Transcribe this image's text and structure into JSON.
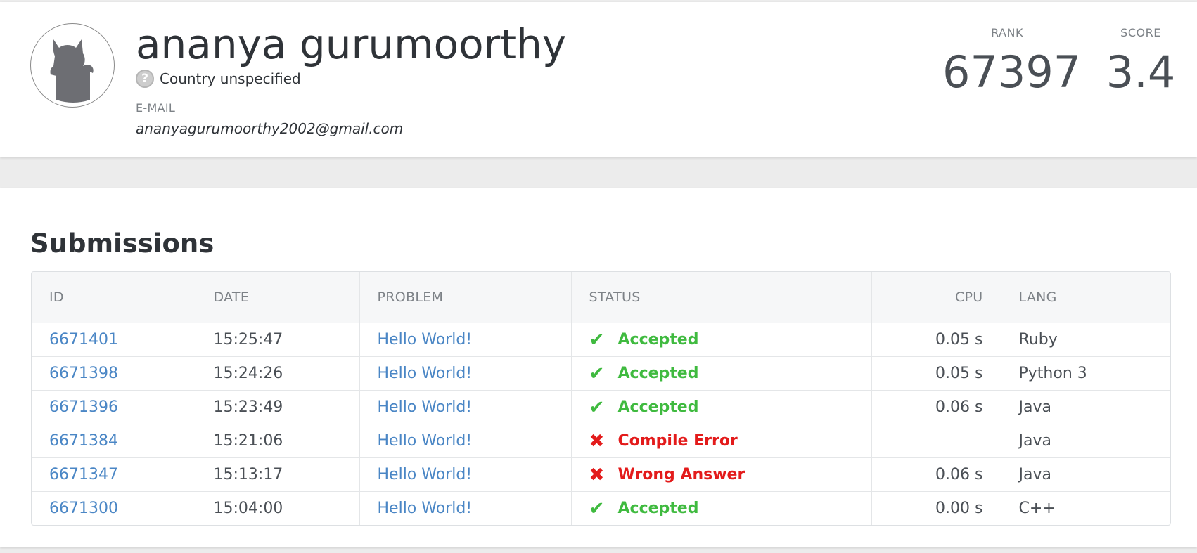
{
  "profile": {
    "name": "ananya gurumoorthy",
    "country": "Country unspecified",
    "country_icon": "question-mark-icon",
    "email_label": "E-MAIL",
    "email": "ananyagurumoorthy2002@gmail.com",
    "rank_label": "RANK",
    "rank": "67397",
    "score_label": "SCORE",
    "score": "3.4"
  },
  "submissions": {
    "title": "Submissions",
    "headers": {
      "id": "ID",
      "date": "DATE",
      "problem": "PROBLEM",
      "status": "STATUS",
      "cpu": "CPU",
      "lang": "LANG"
    },
    "rows": [
      {
        "id": "6671401",
        "date": "15:25:47",
        "problem": "Hello World!",
        "status": "Accepted",
        "ok": true,
        "cpu": "0.05 s",
        "lang": "Ruby"
      },
      {
        "id": "6671398",
        "date": "15:24:26",
        "problem": "Hello World!",
        "status": "Accepted",
        "ok": true,
        "cpu": "0.05 s",
        "lang": "Python 3"
      },
      {
        "id": "6671396",
        "date": "15:23:49",
        "problem": "Hello World!",
        "status": "Accepted",
        "ok": true,
        "cpu": "0.06 s",
        "lang": "Java"
      },
      {
        "id": "6671384",
        "date": "15:21:06",
        "problem": "Hello World!",
        "status": "Compile Error",
        "ok": false,
        "cpu": "",
        "lang": "Java"
      },
      {
        "id": "6671347",
        "date": "15:13:17",
        "problem": "Hello World!",
        "status": "Wrong Answer",
        "ok": false,
        "cpu": "0.06 s",
        "lang": "Java"
      },
      {
        "id": "6671300",
        "date": "15:04:00",
        "problem": "Hello World!",
        "status": "Accepted",
        "ok": true,
        "cpu": "0.00 s",
        "lang": "C++"
      }
    ]
  },
  "colors": {
    "link": "#4a86c5",
    "accepted": "#3fba3f",
    "error": "#e31b1b"
  }
}
